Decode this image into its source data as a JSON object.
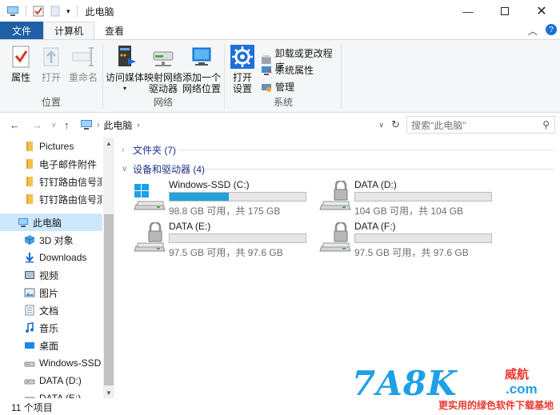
{
  "window": {
    "title": "此电脑",
    "controls": [
      "minimize-icon",
      "maximize-icon",
      "close-icon"
    ]
  },
  "ribbon_tabs": {
    "file": "文件",
    "computer": "计算机",
    "view": "查看"
  },
  "ribbon": {
    "location_group": {
      "label": "位置",
      "properties": "属性",
      "open": "打开",
      "rename": "重命名"
    },
    "network_group": {
      "label": "网络",
      "access_media_line1": "访问媒体",
      "map_drive_line1": "映射网络",
      "map_drive_line2": "驱动器",
      "add_location_line1": "添加一个",
      "add_location_line2": "网络位置"
    },
    "system_group": {
      "label": "系统",
      "open_settings_line1": "打开",
      "open_settings_line2": "设置",
      "uninstall": "卸载或更改程序",
      "system_properties": "系统属性",
      "manage": "管理"
    }
  },
  "address": {
    "path": "此电脑",
    "search_placeholder": "搜索\"此电脑\""
  },
  "sidebar": {
    "items": [
      {
        "label": "Pictures",
        "icon": "folder-icon"
      },
      {
        "label": "电子邮件附件",
        "icon": "folder-icon"
      },
      {
        "label": "钉钉路由信号测试",
        "icon": "folder-icon"
      },
      {
        "label": "钉钉路由信号测试",
        "icon": "folder-icon"
      },
      {
        "label": "此电脑",
        "icon": "computer-icon"
      },
      {
        "label": "3D 对象",
        "icon": "cube-icon"
      },
      {
        "label": "Downloads",
        "icon": "download-icon"
      },
      {
        "label": "视频",
        "icon": "video-icon"
      },
      {
        "label": "图片",
        "icon": "picture-icon"
      },
      {
        "label": "文档",
        "icon": "document-icon"
      },
      {
        "label": "音乐",
        "icon": "music-icon"
      },
      {
        "label": "桌面",
        "icon": "desktop-icon"
      },
      {
        "label": "Windows-SSD (",
        "icon": "drive-icon"
      },
      {
        "label": "DATA (D:)",
        "icon": "drive-icon"
      },
      {
        "label": "DATA (E:)",
        "icon": "drive-icon"
      }
    ]
  },
  "main": {
    "folders_header": "文件夹 (7)",
    "drives_header": "设备和驱动器 (4)",
    "drives": [
      {
        "name": "Windows-SSD (C:)",
        "info": "98.8 GB 可用，共 175 GB",
        "used_fraction": 0.435,
        "icon": "windows-drive-icon"
      },
      {
        "name": "DATA (D:)",
        "info": "104 GB 可用，共 104 GB",
        "used_fraction": 0.0,
        "icon": "locked-drive-icon"
      },
      {
        "name": "DATA (E:)",
        "info": "97.5 GB 可用，共 97.6 GB",
        "used_fraction": 0.0,
        "icon": "locked-drive-icon"
      },
      {
        "name": "DATA (F:)",
        "info": "97.5 GB 可用，共 97.6 GB",
        "used_fraction": 0.0,
        "icon": "locked-drive-icon"
      }
    ]
  },
  "status": {
    "items_count": "11 个项目"
  },
  "watermark": {
    "logo": "7A8K",
    "cn": "威航",
    "domain": ".com",
    "slogan": "更实用的绿色软件下载基地"
  },
  "colors": {
    "file_tab": "#1e5fa6",
    "selection": "#cce8ff",
    "drive_fill": "#26a0da",
    "group_header": "#1e3287"
  }
}
